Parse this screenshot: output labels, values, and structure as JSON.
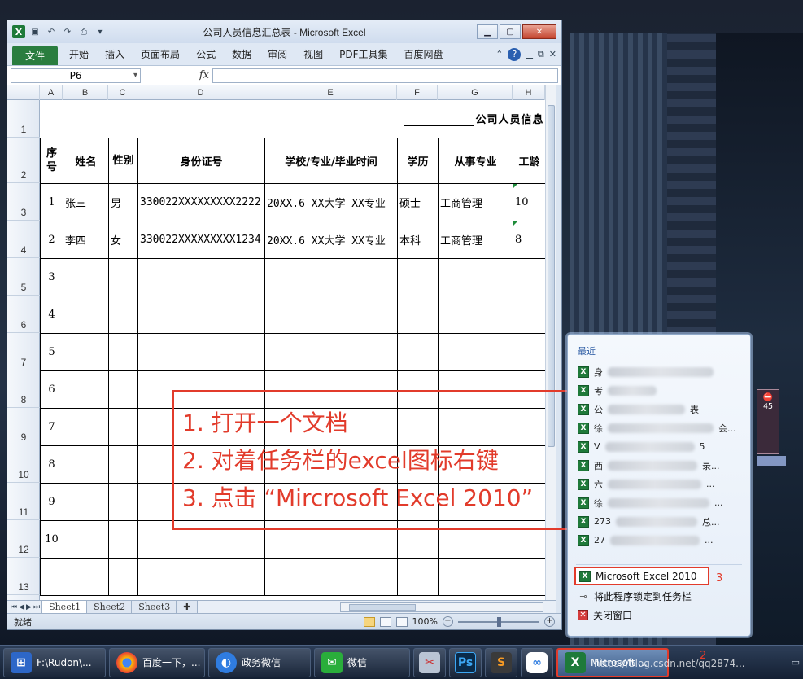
{
  "window": {
    "title": "公司人员信息汇总表 - Microsoft Excel",
    "qat_icons": [
      "excel-icon",
      "save-icon",
      "undo-icon",
      "redo-icon",
      "print-preview-icon",
      "customize-icon"
    ]
  },
  "ribbon": {
    "tabs": [
      "文件",
      "开始",
      "插入",
      "页面布局",
      "公式",
      "数据",
      "审阅",
      "视图",
      "PDF工具集",
      "百度网盘"
    ],
    "help": "?"
  },
  "formula_bar": {
    "name_box": "P6",
    "fx": "fx",
    "value": ""
  },
  "sheet": {
    "columns": [
      "A",
      "B",
      "C",
      "D",
      "E",
      "F",
      "G",
      "H"
    ],
    "rows": [
      "1",
      "2",
      "3",
      "4",
      "5",
      "6",
      "7",
      "8",
      "9",
      "10",
      "11",
      "12",
      "13"
    ],
    "title": "公司人员信息",
    "headers": [
      "序号",
      "姓名",
      "性别",
      "身份证号",
      "学校/专业/毕业时间",
      "学历",
      "从事专业",
      "工龄"
    ],
    "data_rows": [
      [
        "1",
        "张三",
        "男",
        "330022XXXXXXXXX2222",
        "20XX.6 XX大学 XX专业",
        "硕士",
        "工商管理",
        "10"
      ],
      [
        "2",
        "李四",
        "女",
        "330022XXXXXXXXX1234",
        "20XX.6 XX大学 XX专业",
        "本科",
        "工商管理",
        "8"
      ],
      [
        "3",
        "",
        "",
        "",
        "",
        "",
        "",
        ""
      ],
      [
        "4",
        "",
        "",
        "",
        "",
        "",
        "",
        ""
      ],
      [
        "5",
        "",
        "",
        "",
        "",
        "",
        "",
        ""
      ],
      [
        "6",
        "",
        "",
        "",
        "",
        "",
        "",
        ""
      ],
      [
        "7",
        "",
        "",
        "",
        "",
        "",
        "",
        ""
      ],
      [
        "8",
        "",
        "",
        "",
        "",
        "",
        "",
        ""
      ],
      [
        "9",
        "",
        "",
        "",
        "",
        "",
        "",
        ""
      ],
      [
        "10",
        "",
        "",
        "",
        "",
        "",
        "",
        ""
      ],
      [
        "",
        "",
        "",
        "",
        "",
        "",
        "",
        ""
      ]
    ],
    "tabs": [
      "Sheet1",
      "Sheet2",
      "Sheet3"
    ]
  },
  "status": {
    "ready": "就绪",
    "zoom": "100%"
  },
  "annotation": {
    "lines": [
      "1. 打开一个文档",
      "2. 对着任务栏的excel图标右键",
      "3. 点击 “Mircrosoft Excel 2010”"
    ],
    "step2": "2",
    "step3": "3"
  },
  "jumplist": {
    "recent_label": "最近",
    "recent_items": [
      "身",
      "考",
      "公",
      "徐",
      "V",
      "西",
      "六",
      "徐",
      "273",
      "27"
    ],
    "recent_suffixes": [
      "",
      "",
      "表",
      "会...",
      "5",
      "录...",
      "...",
      "...",
      "总...",
      "..."
    ],
    "tasks": {
      "open_app": "Microsoft Excel 2010",
      "pin": "将此程序锁定到任务栏",
      "close": "关闭窗口"
    }
  },
  "taskbar": {
    "items": [
      {
        "label": "F:\\Rudon\\...",
        "icon": "folder-icon"
      },
      {
        "label": "百度一下，...",
        "icon": "chrome-icon"
      },
      {
        "label": "政务微信",
        "icon": "gov-wechat-icon"
      },
      {
        "label": "微信",
        "icon": "wechat-icon"
      }
    ],
    "excel_label": "Microsoft ...",
    "watermark": "https://blog.csdn.net/qq2874..."
  },
  "colors": {
    "accent_red": "#e23b2b",
    "excel_green": "#1e7a3a"
  }
}
